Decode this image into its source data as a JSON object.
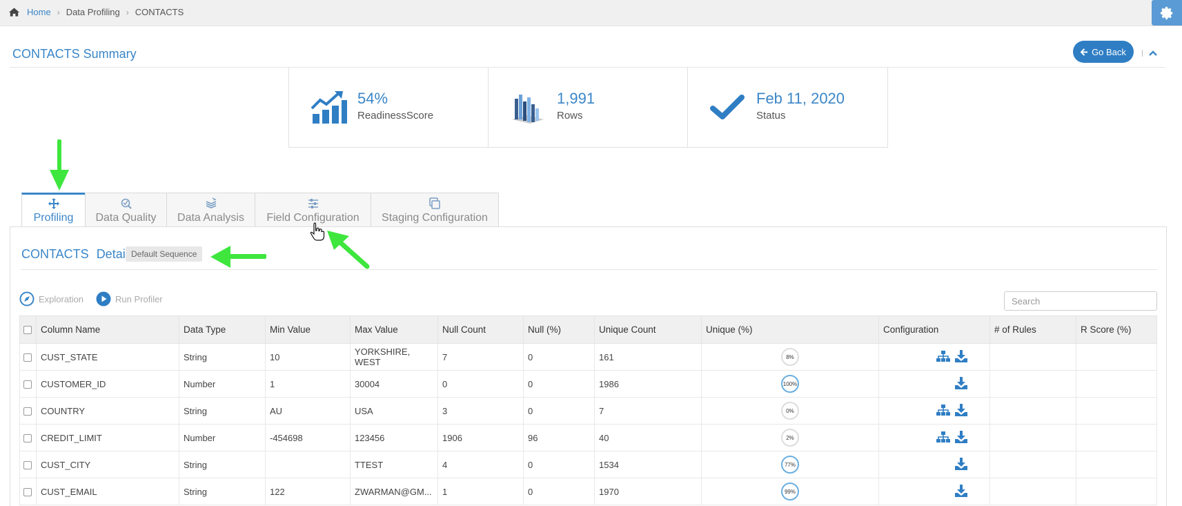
{
  "breadcrumb": {
    "home": "Home",
    "section": "Data Profiling",
    "current": "CONTACTS"
  },
  "summary": {
    "title": "CONTACTS Summary",
    "go_back": "Go Back"
  },
  "stats": [
    {
      "value": "54%",
      "label": "ReadinessScore",
      "icon": "chart-growth-icon"
    },
    {
      "value": "1,991",
      "label": "Rows",
      "icon": "bar-chart-3d-icon"
    },
    {
      "value": "Feb 11, 2020",
      "label": "Status",
      "icon": "check-icon"
    }
  ],
  "tabs": [
    {
      "label": "Profiling",
      "icon": "move-arrows-icon",
      "active": true
    },
    {
      "label": "Data Quality",
      "icon": "magnify-check-icon"
    },
    {
      "label": "Data Analysis",
      "icon": "stack-icon"
    },
    {
      "label": "Field Configuration",
      "icon": "sliders-icon"
    },
    {
      "label": "Staging Configuration",
      "icon": "copy-icon"
    }
  ],
  "detail": {
    "title_entity": "CONTACTS",
    "title_word": "Detail",
    "sequence_badge": "Default Sequence"
  },
  "toolbar": {
    "exploration": "Exploration",
    "run_profiler": "Run Profiler",
    "search_placeholder": "Search"
  },
  "table": {
    "columns": [
      "Column Name",
      "Data Type",
      "Min Value",
      "Max Value",
      "Null Count",
      "Null (%)",
      "Unique Count",
      "Unique (%)",
      "Configuration",
      "# of Rules",
      "R Score (%)"
    ],
    "rows": [
      {
        "name": "CUST_STATE",
        "type": "String",
        "min": "10",
        "max": "YORKSHIRE, WEST",
        "null_count": "7",
        "null_pct": "0",
        "unique_count": "161",
        "unique_pct": "8%",
        "unique_frac": 0.08,
        "hierarchy": true
      },
      {
        "name": "CUSTOMER_ID",
        "type": "Number",
        "min": "1",
        "max": "30004",
        "null_count": "0",
        "null_pct": "0",
        "unique_count": "1986",
        "unique_pct": "100%",
        "unique_frac": 1.0,
        "hierarchy": false
      },
      {
        "name": "COUNTRY",
        "type": "String",
        "min": "AU",
        "max": "USA",
        "null_count": "3",
        "null_pct": "0",
        "unique_count": "7",
        "unique_pct": "0%",
        "unique_frac": 0.0,
        "hierarchy": true
      },
      {
        "name": "CREDIT_LIMIT",
        "type": "Number",
        "min": "-454698",
        "max": "123456",
        "null_count": "1906",
        "null_pct": "96",
        "unique_count": "40",
        "unique_pct": "2%",
        "unique_frac": 0.02,
        "hierarchy": true
      },
      {
        "name": "CUST_CITY",
        "type": "String",
        "min": "",
        "max": "TTEST",
        "null_count": "4",
        "null_pct": "0",
        "unique_count": "1534",
        "unique_pct": "77%",
        "unique_frac": 0.77,
        "hierarchy": false
      },
      {
        "name": "CUST_EMAIL",
        "type": "String",
        "min": "122",
        "max": "ZWARMAN@GM...",
        "null_count": "1",
        "null_pct": "0",
        "unique_count": "1970",
        "unique_pct": "99%",
        "unique_frac": 0.99,
        "hierarchy": false
      }
    ]
  },
  "colors": {
    "accent": "#3a86c8",
    "annotation_arrow": "#3ee63e"
  }
}
